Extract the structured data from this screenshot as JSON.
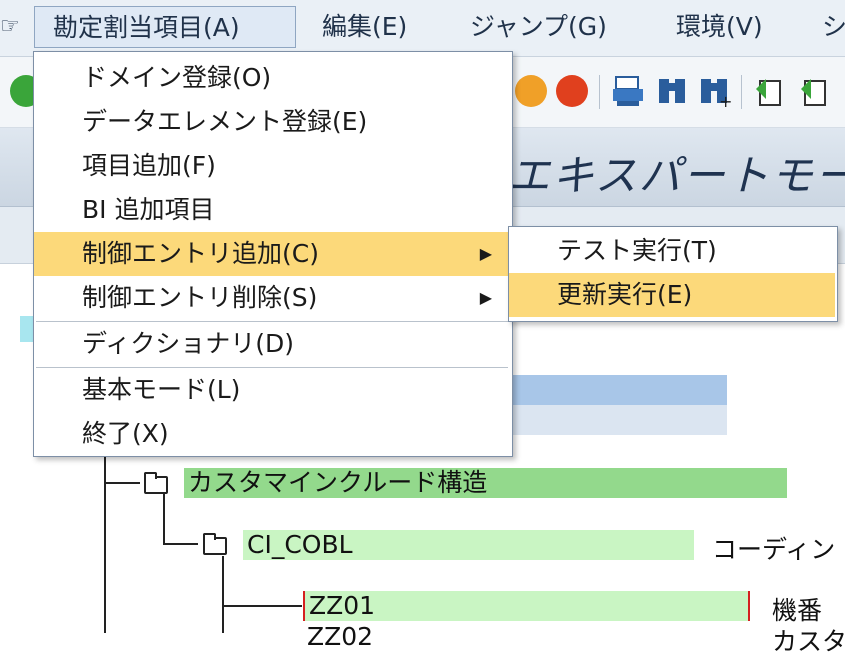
{
  "menubar": {
    "items": [
      {
        "label": "勘定割当項目(A)"
      },
      {
        "label": "編集(E)"
      },
      {
        "label": "ジャンプ(G)"
      },
      {
        "label": "環境(V)"
      },
      {
        "label": "シ"
      }
    ]
  },
  "title": "エキスパートモー",
  "tree": {
    "nodes": [
      {
        "label": "カスタマインクルード構造",
        "color": "#93d98c"
      },
      {
        "label": "CI_COBL",
        "desc": "コーディン",
        "color": "#c9f5c3"
      },
      {
        "label": "ZZ01",
        "desc": "機番",
        "color": "#c9f5c3"
      },
      {
        "label": "ZZ02",
        "desc": "カスタ"
      }
    ]
  },
  "menu": {
    "items": [
      {
        "label": "ドメイン登録(O)"
      },
      {
        "label": "データエレメント登録(E)"
      },
      {
        "label": "項目追加(F)"
      },
      {
        "label": "BI 追加項目"
      },
      {
        "label": "制御エントリ追加(C)",
        "submenu": true,
        "highlighted": true
      },
      {
        "label": "制御エントリ削除(S)",
        "submenu": true
      },
      {
        "label": "ディクショナリ(D)"
      },
      {
        "label": "基本モード(L)"
      },
      {
        "label": "終了(X)"
      }
    ]
  },
  "submenu": {
    "items": [
      {
        "label": "テスト実行(T)"
      },
      {
        "label": "更新実行(E)",
        "highlighted": true
      }
    ]
  },
  "colors": {
    "highlight": "#fcd97a",
    "tree_green": "#93d98c",
    "tree_light_green": "#c9f5c3",
    "selection_blue": "#a8c6e8"
  }
}
